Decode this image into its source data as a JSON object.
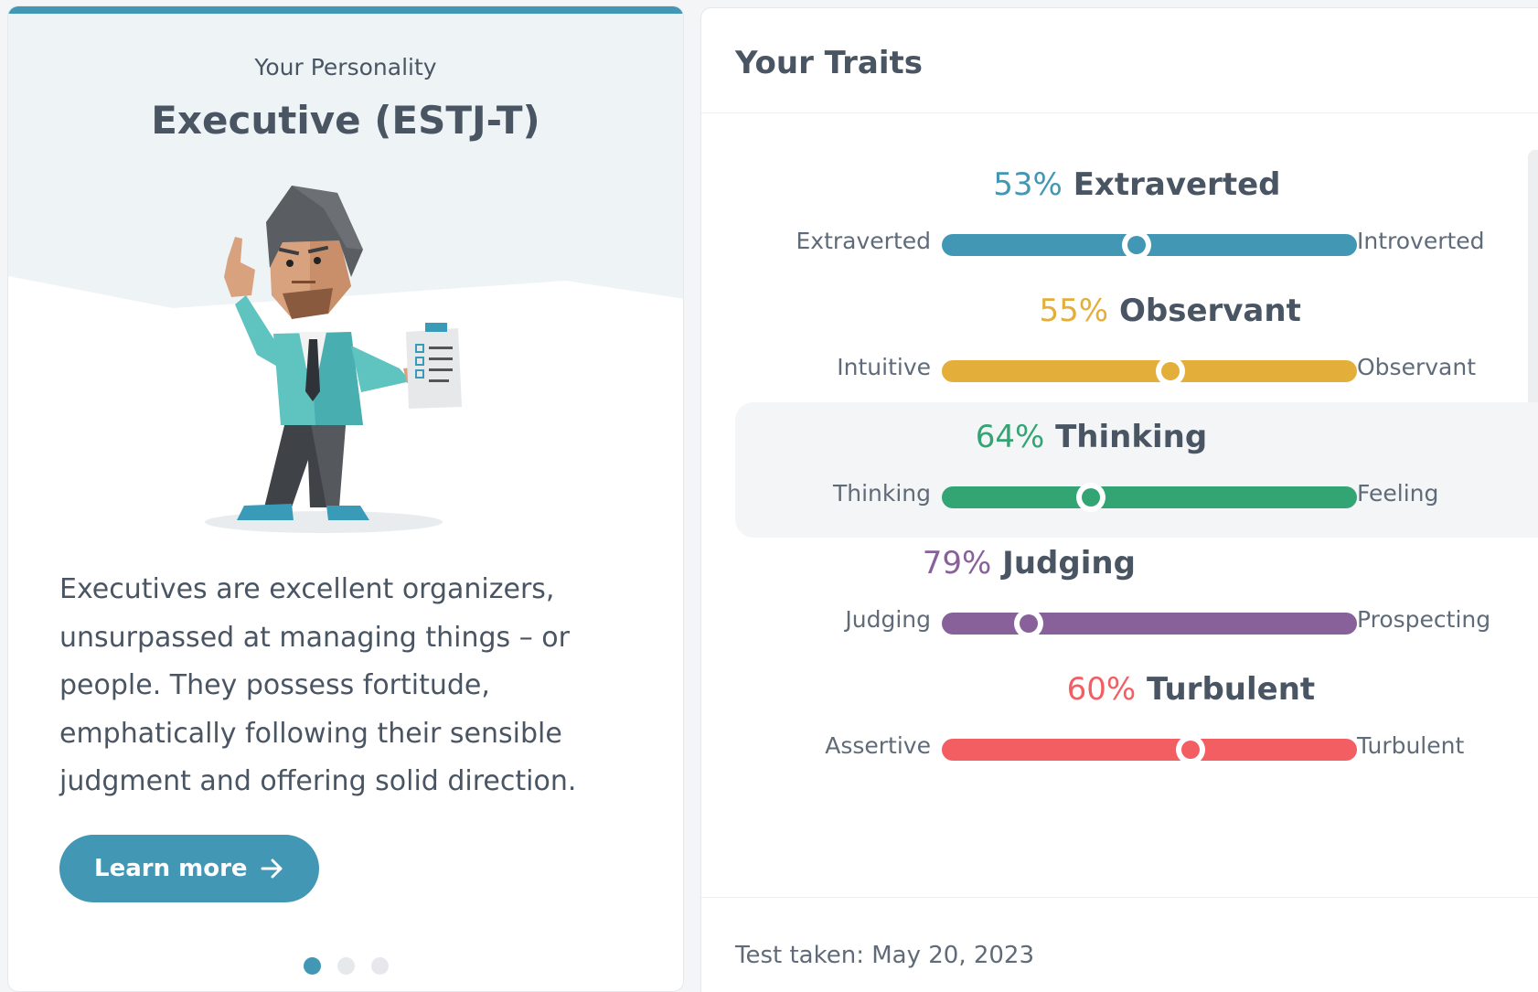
{
  "personality": {
    "subtitle": "Your Personality",
    "type": "Executive (ESTJ-T)",
    "description": "Executives are excellent organizers, unsurpassed at managing things – or people. They possess fortitude, emphatically following their sensible judgment and offering solid direction.",
    "learn_more": "Learn more",
    "carousel_dots": 3,
    "active_dot": 0,
    "accent_color": "#4298b4"
  },
  "traits_card": {
    "title": "Your Traits",
    "test_taken": "Test taken: May 20, 2023",
    "traits": [
      {
        "percent": "53%",
        "name": "Extraverted",
        "left": "Extraverted",
        "right": "Introverted",
        "color": "#4298b4",
        "position": 0.47,
        "highlighted": false
      },
      {
        "percent": "55%",
        "name": "Observant",
        "left": "Intuitive",
        "right": "Observant",
        "color": "#e4ae3a",
        "position": 0.55,
        "highlighted": false
      },
      {
        "percent": "64%",
        "name": "Thinking",
        "left": "Thinking",
        "right": "Feeling",
        "color": "#33a474",
        "position": 0.36,
        "highlighted": true
      },
      {
        "percent": "79%",
        "name": "Judging",
        "left": "Judging",
        "right": "Prospecting",
        "color": "#88619a",
        "position": 0.21,
        "highlighted": false
      },
      {
        "percent": "60%",
        "name": "Turbulent",
        "left": "Assertive",
        "right": "Turbulent",
        "color": "#f25e62",
        "position": 0.6,
        "highlighted": false
      }
    ]
  }
}
